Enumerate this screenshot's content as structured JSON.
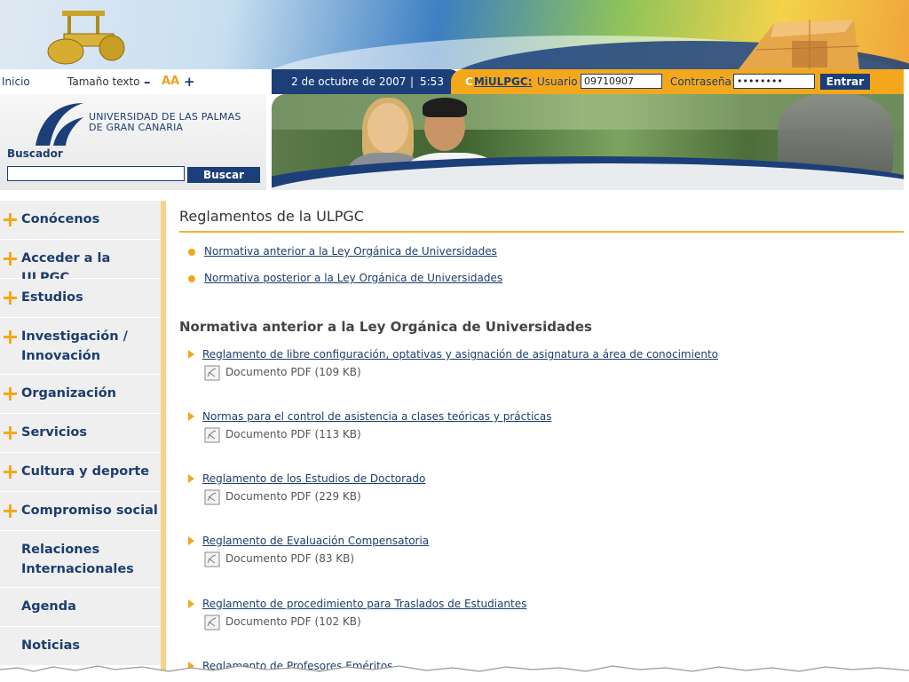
{
  "toolbar": {
    "home": "Inicio",
    "text_size_label": "Tamaño texto",
    "text_smaller": "–",
    "text_size_icon": "AA",
    "text_larger": "+",
    "date": "2 de octubre de 2007",
    "separator": "|",
    "time": "5:53"
  },
  "login": {
    "portal_label": "MiULPGC:",
    "user_label": "Usuario",
    "user_value": "09710907",
    "password_label": "Contraseña",
    "password_value": "********",
    "submit": "Entrar"
  },
  "logo": {
    "line1": "UNIVERSIDAD DE LAS PALMAS",
    "line2": "DE GRAN CANARIA"
  },
  "search": {
    "label": "Buscador",
    "value": "",
    "button": "Buscar"
  },
  "sidebar": {
    "items": [
      {
        "label": "Conócenos",
        "icon": "plus-icon"
      },
      {
        "label": "Acceder a la ULPGC",
        "icon": "plus-icon"
      },
      {
        "label": "Estudios",
        "icon": "plus-icon"
      },
      {
        "label": "Investigación /",
        "label2": "Innovación",
        "icon": "plus-icon"
      },
      {
        "label": "Organización",
        "icon": "plus-icon"
      },
      {
        "label": "Servicios",
        "icon": "plus-icon"
      },
      {
        "label": "Cultura y deporte",
        "icon": "plus-icon"
      },
      {
        "label": "Compromiso social",
        "icon": "plus-icon"
      },
      {
        "label": "Relaciones",
        "label2": "Internacionales"
      },
      {
        "label": "Agenda"
      },
      {
        "label": "Noticias"
      }
    ]
  },
  "main": {
    "title": "Reglamentos de la ULPGC",
    "toc": [
      "Normativa anterior a la Ley Orgánica de Universidades",
      "Normativa posterior a la Ley Orgánica de Universidades"
    ],
    "section_title": "Normativa anterior a la Ley Orgánica de Universidades",
    "documents": [
      {
        "title": "Reglamento de libre configuración, optativas y asignación de asignatura a área de conocimiento",
        "meta": "Documento PDF (109 KB)"
      },
      {
        "title": "Normas para el control de asistencia a clases teóricas y prácticas",
        "meta": "Documento PDF (113 KB)"
      },
      {
        "title": "Reglamento de los Estudios de Doctorado",
        "meta": "Documento PDF (229 KB)"
      },
      {
        "title": "Reglamento de Evaluación Compensatoria",
        "meta": "Documento PDF (83 KB)"
      },
      {
        "title": "Reglamento de procedimiento para Traslados de Estudiantes",
        "meta": "Documento PDF (102 KB)"
      },
      {
        "title": "Reglamento de Profesores Eméritos",
        "meta": ""
      }
    ]
  },
  "colors": {
    "navy": "#1c3f7a",
    "orange": "#f3a81b",
    "nav_bg": "#efefef"
  }
}
